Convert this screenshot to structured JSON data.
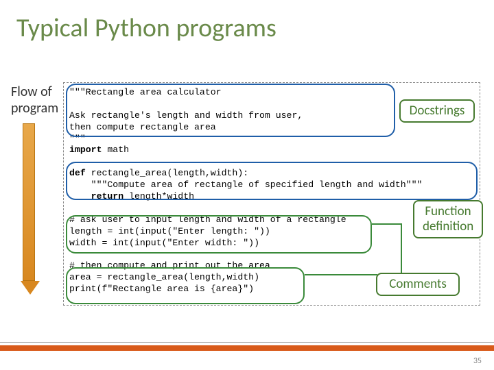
{
  "title": "Typical Python programs",
  "flow_label_line1": "Flow of",
  "flow_label_line2": "program",
  "callouts": {
    "docstrings": "Docstrings",
    "function_def": "Function\ndefinition",
    "comments": "Comments"
  },
  "code": {
    "l1": "\"\"\"Rectangle area calculator",
    "l2": "Ask rectangle's length and width from user,",
    "l3": "then compute rectangle area",
    "l4": "\"\"\"",
    "l5a": "import",
    "l5b": " math",
    "l6a": "def",
    "l6b": " rectangle_area(length,width):",
    "l7": "    \"\"\"Compute area of rectangle of specified length and width\"\"\"",
    "l8a": "    return",
    "l8b": " length*width",
    "l9": "# ask user to input length and width of a rectangle",
    "l10": "length = int(input(\"Enter length: \"))",
    "l11": "width = int(input(\"Enter width: \"))",
    "l12": "# then compute and print out the area",
    "l13": "area = rectangle_area(length,width)",
    "l14": "print(f\"Rectangle area is {area}\")"
  },
  "page_number": "35"
}
